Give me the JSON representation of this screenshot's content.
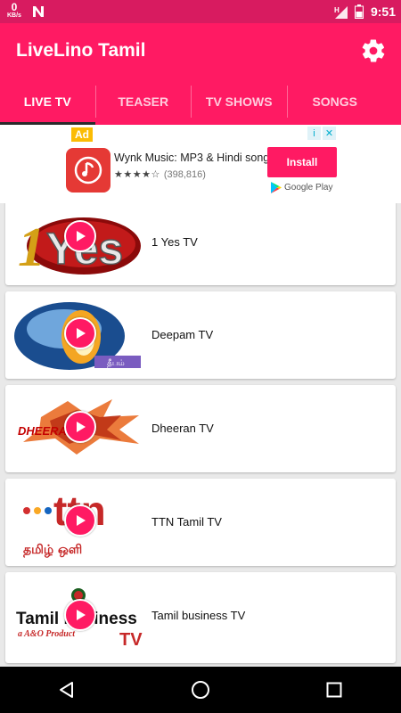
{
  "status_bar": {
    "speed_value": "0",
    "speed_unit": "KB/s",
    "time": "9:51",
    "network": "H"
  },
  "app": {
    "title": "LiveLino Tamil",
    "settings_icon": "gear-icon"
  },
  "tabs": [
    {
      "label": "LIVE TV",
      "active": true
    },
    {
      "label": "TEASER",
      "active": false
    },
    {
      "label": "TV SHOWS",
      "active": false
    },
    {
      "label": "SONGS",
      "active": false
    }
  ],
  "ad": {
    "badge": "Ad",
    "title": "Wynk Music: MP3 & Hindi songs",
    "rating_count": "(398,816)",
    "stars": "4 of 5",
    "install_label": "Install",
    "store_label": "Google Play"
  },
  "channels": [
    {
      "name": "1 Yes TV",
      "logo_text": "Yes",
      "logo_number": "1"
    },
    {
      "name": "Deepam TV",
      "logo_text": "தீபம்"
    },
    {
      "name": "Dheeran TV",
      "logo_text": "DHEERAN TV"
    },
    {
      "name": "TTN Tamil TV",
      "logo_text": "ttn",
      "logo_sub": "தமிழ் ஒளி"
    },
    {
      "name": "Tamil business TV",
      "logo_text": "Tamil business",
      "logo_sub": "a A&O Product",
      "logo_tag": "TV"
    }
  ],
  "colors": {
    "primary": "#ff1a63",
    "status": "#d81b60",
    "accent_yellow": "#fbbc04"
  }
}
